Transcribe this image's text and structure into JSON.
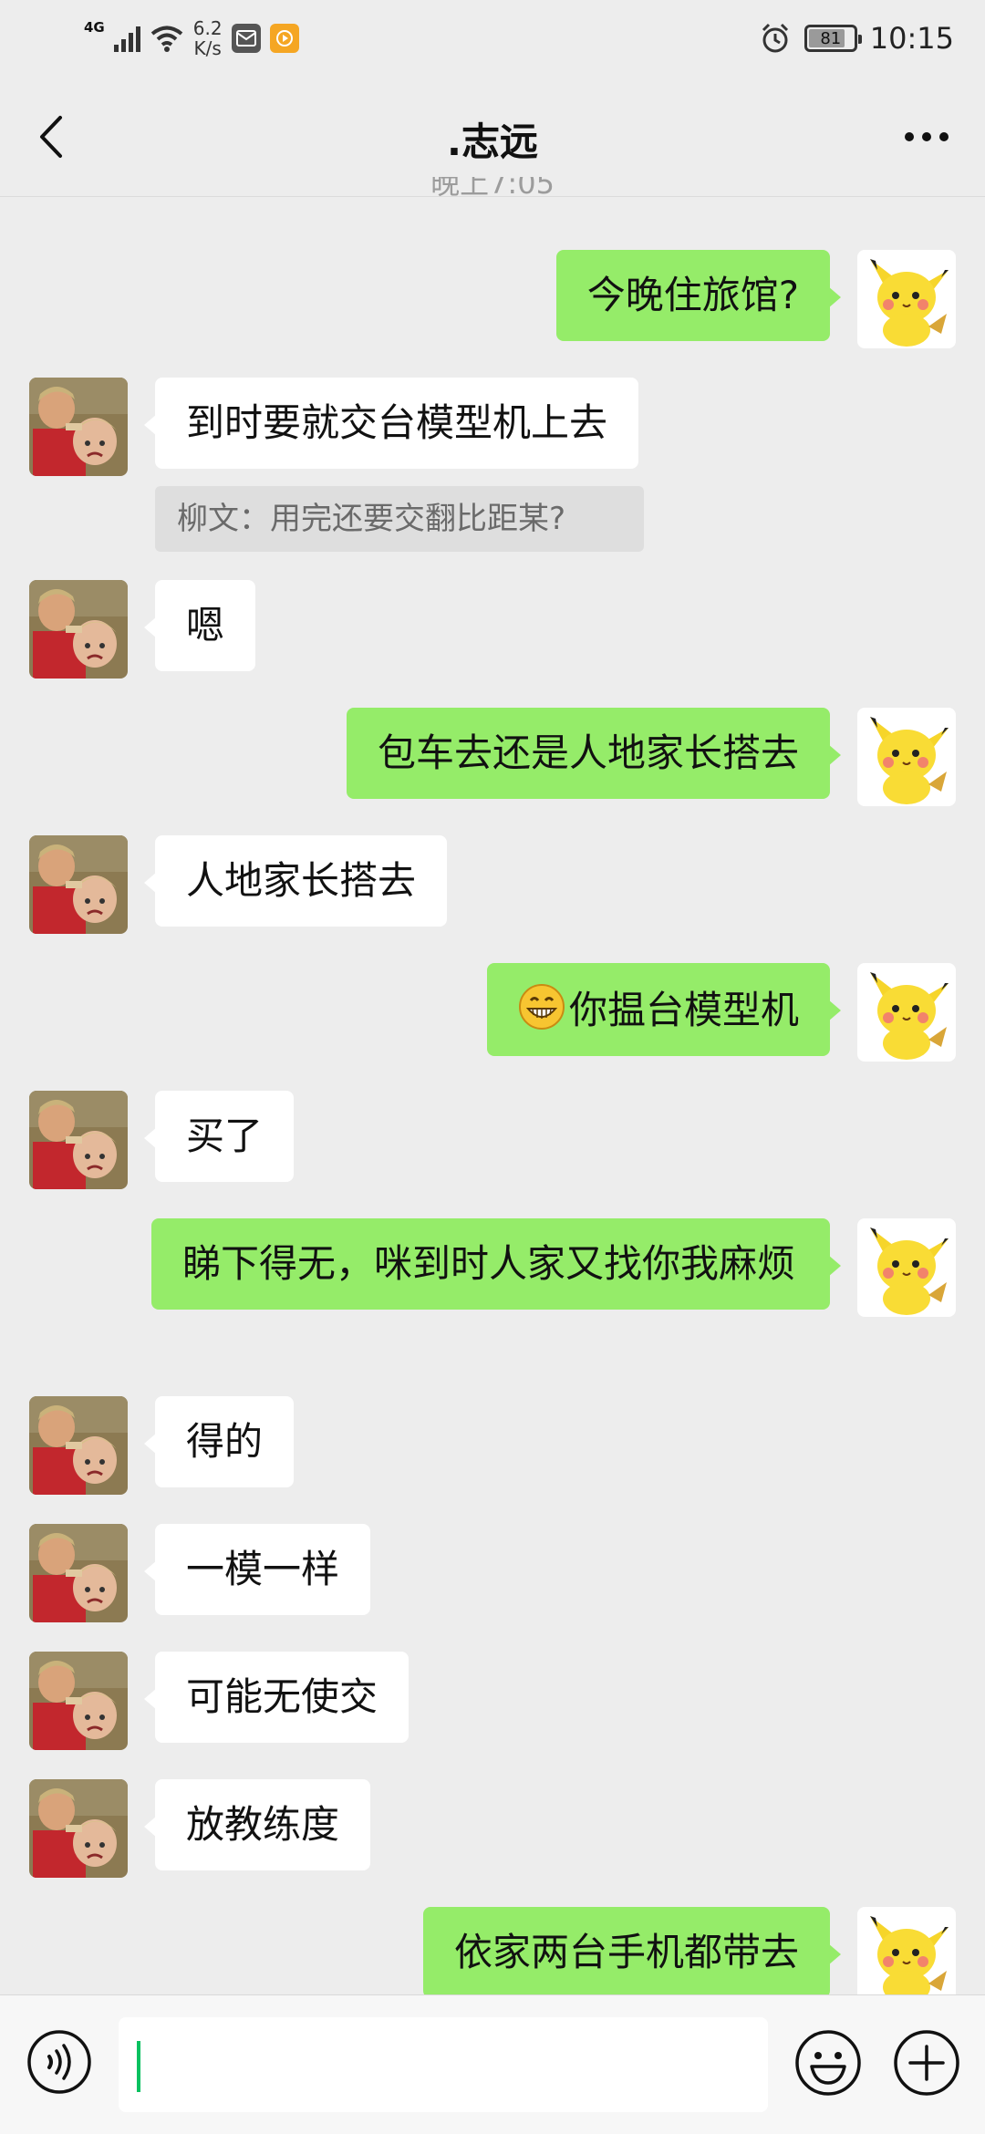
{
  "status_bar": {
    "network": "4G",
    "speed_value": "6.2",
    "speed_unit": "K/s",
    "battery_percent": 81,
    "battery_label": "81",
    "time": "10:15"
  },
  "header": {
    "title": ".志远",
    "time_peek": "晚上7:05"
  },
  "messages": [
    {
      "text": "今晚住旅馆?"
    },
    {
      "text": "到时要就交台模型机上去"
    },
    {
      "quote": "柳文：用完还要交翻比距某?"
    },
    {
      "text": "嗯"
    },
    {
      "text": "包车去还是人地家长搭去"
    },
    {
      "text": "人地家长搭去"
    },
    {
      "text": "你揾台模型机"
    },
    {
      "text": "买了"
    },
    {
      "text": "睇下得无，咪到时人家又找你我麻烦"
    },
    {
      "text": "得的"
    },
    {
      "text": "一模一样"
    },
    {
      "text": "可能无使交"
    },
    {
      "text": "放教练度"
    },
    {
      "text": "依家两台手机都带去"
    }
  ],
  "input": {
    "value": ""
  },
  "colors": {
    "outgoing_bubble": "#95ec69",
    "incoming_bubble": "#ffffff",
    "background": "#ededed",
    "cursor": "#07c160"
  },
  "icons": [
    "back-arrow-icon",
    "more-dots-icon",
    "voice-icon",
    "emoji-icon",
    "plus-icon",
    "grin-emoji-icon"
  ]
}
